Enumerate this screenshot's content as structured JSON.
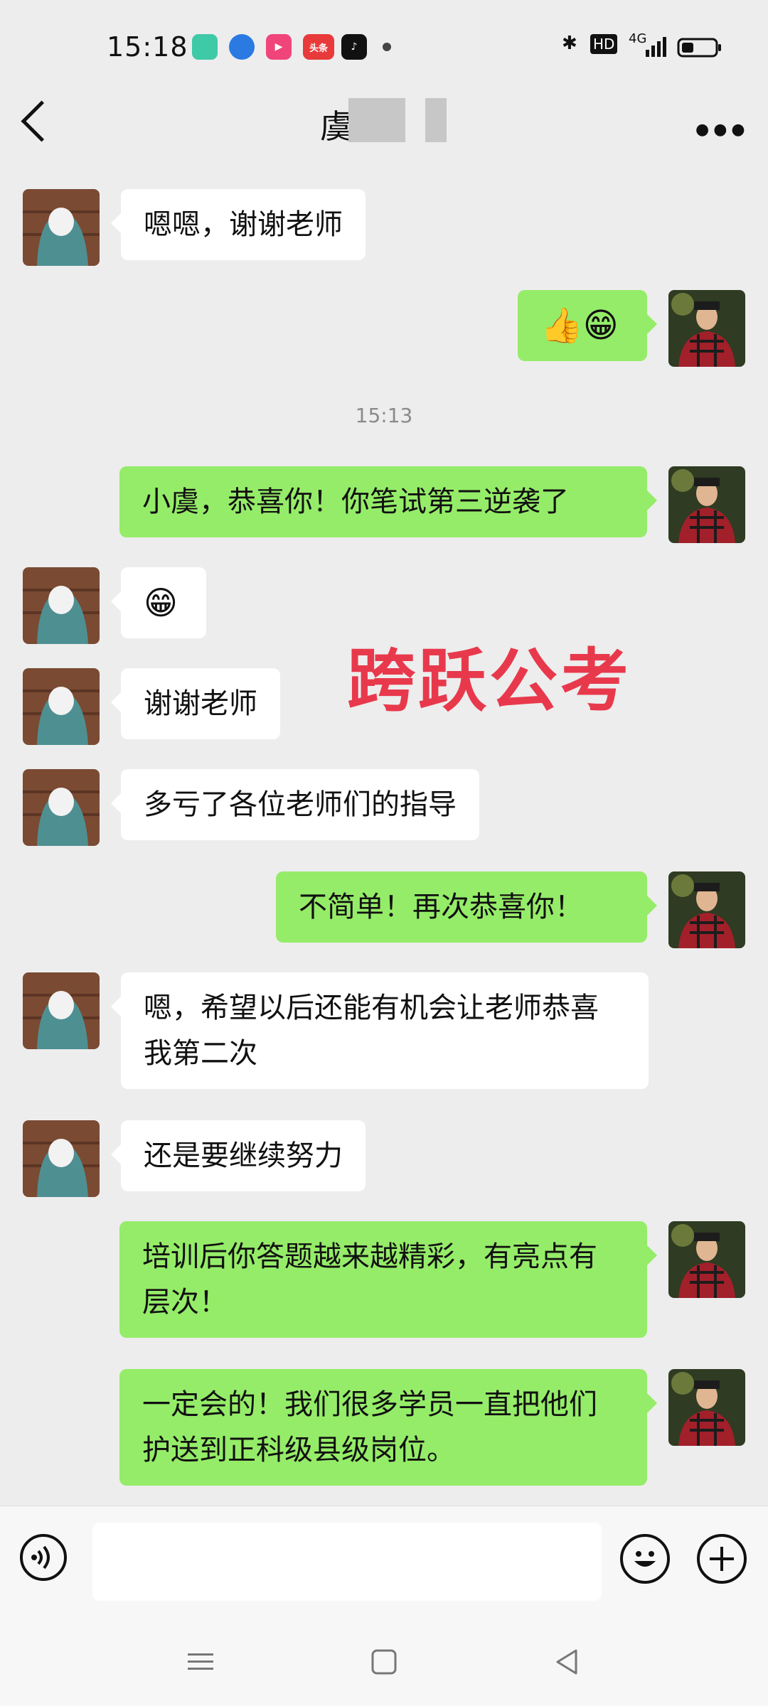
{
  "status_bar": {
    "time": "15:18",
    "right_text": "HD",
    "network": "4G",
    "app_icons": [
      "chat-app-icon",
      "browser-app-icon",
      "video-app-icon",
      "toutiao-app-icon",
      "tiktok-app-icon",
      "dot-icon"
    ],
    "toutiao_label": "头条"
  },
  "header": {
    "title": "虞",
    "back_icon": "back-arrow-icon",
    "more_icon": "more-dots-icon"
  },
  "timestamp": "15:13",
  "watermark": "跨跃公考",
  "messages": [
    {
      "side": "in",
      "text": "嗯嗯，谢谢老师"
    },
    {
      "side": "out",
      "text": "👍😁"
    },
    {
      "side": "out",
      "text": "小虞，恭喜你！你笔试第三逆袭了"
    },
    {
      "side": "in",
      "text": "😁"
    },
    {
      "side": "in",
      "text": "谢谢老师"
    },
    {
      "side": "in",
      "text": "多亏了各位老师们的指导"
    },
    {
      "side": "out",
      "text": "不简单！再次恭喜你！"
    },
    {
      "side": "in",
      "text": "嗯，希望以后还能有机会让老师恭喜我第二次"
    },
    {
      "side": "in",
      "text": "还是要继续努力"
    },
    {
      "side": "out",
      "text": "培训后你答题越来越精彩，有亮点有层次！"
    },
    {
      "side": "out",
      "text": "一定会的！我们很多学员一直把他们护送到正科级县级岗位。"
    }
  ],
  "input": {
    "placeholder": ""
  },
  "colors": {
    "incoming_bubble": "#ffffff",
    "outgoing_bubble": "#95ec69",
    "background": "#ededed",
    "watermark": "#e8394c"
  }
}
